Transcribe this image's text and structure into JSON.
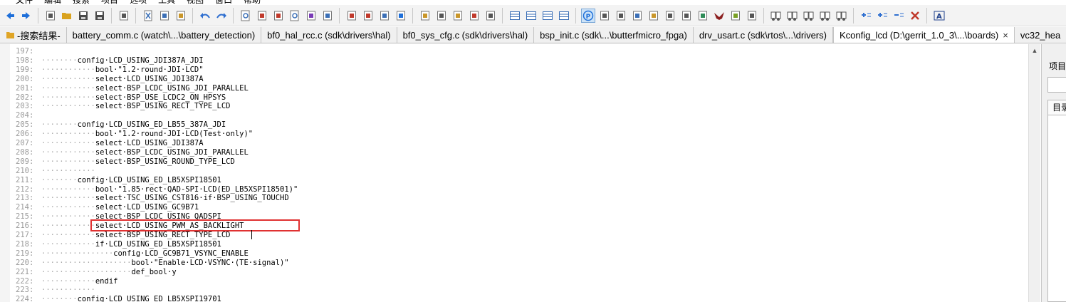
{
  "menu": [
    "文件",
    "编辑",
    "搜索",
    "项目",
    "选项",
    "工具",
    "视图",
    "窗口",
    "帮助"
  ],
  "toolbar": {
    "icons": [
      {
        "name": "back-arrow-icon",
        "color": "#1e6fd9"
      },
      {
        "name": "forward-arrow-icon",
        "color": "#1e6fd9"
      },
      {
        "sep": true
      },
      {
        "name": "new-file-icon",
        "color": "#555555"
      },
      {
        "name": "open-folder-icon",
        "color": "#d9a21e"
      },
      {
        "name": "save-icon",
        "color": "#4a4a4a"
      },
      {
        "name": "save-all-icon",
        "color": "#4a4a4a"
      },
      {
        "sep": true
      },
      {
        "name": "print-icon",
        "color": "#555555"
      },
      {
        "sep": true
      },
      {
        "name": "cut-icon",
        "color": "#3b6fb6"
      },
      {
        "name": "copy-icon",
        "color": "#3b6fb6"
      },
      {
        "name": "paste-icon",
        "color": "#c9962a"
      },
      {
        "sep": true
      },
      {
        "name": "undo-icon",
        "color": "#2f6fd0"
      },
      {
        "name": "redo-icon",
        "color": "#2f6fd0"
      },
      {
        "sep": true
      },
      {
        "name": "find-icon",
        "color": "#3b6fb6"
      },
      {
        "name": "find-previous-icon",
        "color": "#c0392b"
      },
      {
        "name": "find-next-icon",
        "color": "#c0392b"
      },
      {
        "name": "find-in-files-icon",
        "color": "#3b6fb6"
      },
      {
        "name": "replace-icon",
        "color": "#7a3bb6"
      },
      {
        "name": "web-search-icon",
        "color": "#3b6fb6"
      },
      {
        "sep": true
      },
      {
        "name": "bookmark-prev-icon",
        "color": "#c0392b"
      },
      {
        "name": "bookmark-next-icon",
        "color": "#c0392b"
      },
      {
        "name": "goto-line-icon",
        "color": "#3b6fb6"
      },
      {
        "name": "bookmark-toggle-icon",
        "color": "#1e6fd9"
      },
      {
        "sep": true
      },
      {
        "name": "match-brace-icon",
        "color": "#c9962a"
      },
      {
        "name": "indent-icon",
        "color": "#555555"
      },
      {
        "name": "book-icon",
        "color": "#c9962a"
      },
      {
        "name": "function-icon",
        "color": "#c0392b"
      },
      {
        "name": "tools-icon",
        "color": "#555555"
      },
      {
        "sep": true
      },
      {
        "name": "layout-1-icon",
        "color": "#3b6fb6"
      },
      {
        "name": "layout-2-icon",
        "color": "#3b6fb6"
      },
      {
        "name": "layout-3-icon",
        "color": "#3b6fb6"
      },
      {
        "name": "layout-4-icon",
        "color": "#3b6fb6"
      },
      {
        "sep": true
      },
      {
        "name": "show-whitespace-icon",
        "color": "#1e6fd9",
        "pressed": true
      },
      {
        "name": "fullscreen-icon",
        "color": "#555555"
      },
      {
        "name": "tree-icon",
        "color": "#555555"
      },
      {
        "name": "symbol-icon",
        "color": "#3b6fb6"
      },
      {
        "name": "outline-icon",
        "color": "#c9962a"
      },
      {
        "name": "help-icon",
        "color": "#555555"
      },
      {
        "name": "tag-icon",
        "color": "#555555"
      },
      {
        "name": "package-icon",
        "color": "#2e8b57"
      },
      {
        "name": "bird-icon",
        "color": "#8b1e1e"
      },
      {
        "name": "plugin-icon",
        "color": "#7aa025"
      },
      {
        "name": "grid-icon",
        "color": "#555555"
      },
      {
        "sep": true
      },
      {
        "name": "compare-1-icon",
        "color": "#555555"
      },
      {
        "name": "compare-2-icon",
        "color": "#555555"
      },
      {
        "name": "compare-3-icon",
        "color": "#555555"
      },
      {
        "name": "compare-4-icon",
        "color": "#555555"
      },
      {
        "name": "compare-5-icon",
        "color": "#555555"
      },
      {
        "sep": true
      },
      {
        "name": "add-marker-icon",
        "color": "#2f6fd0"
      },
      {
        "name": "add-item-icon",
        "color": "#2f6fd0"
      },
      {
        "name": "remove-item-icon",
        "color": "#2f6fd0"
      },
      {
        "name": "delete-icon",
        "color": "#c0392b"
      },
      {
        "sep": true
      },
      {
        "name": "font-icon",
        "color": "#1e3f8b"
      }
    ]
  },
  "tabs": [
    {
      "label": "-搜索结果-",
      "icon": true
    },
    {
      "label": "battery_comm.c (watch\\...\\battery_detection)"
    },
    {
      "label": "bf0_hal_rcc.c (sdk\\drivers\\hal)"
    },
    {
      "label": "bf0_sys_cfg.c (sdk\\drivers\\hal)"
    },
    {
      "label": "bsp_init.c (sdk\\...\\butterfmicro_fpga)"
    },
    {
      "label": "drv_usart.c (sdk\\rtos\\...\\drivers)"
    },
    {
      "label": "Kconfig_lcd (D:\\gerrit_1.0_3\\...\\boards)",
      "active": true,
      "close": "×"
    },
    {
      "label": "vc32_hea"
    }
  ],
  "code": [
    {
      "ln": "197:",
      "ws": "",
      "text": ""
    },
    {
      "ln": "198:",
      "ws": "········",
      "text": "config·LCD_USING_JDI387A_JDI"
    },
    {
      "ln": "199:",
      "ws": "············",
      "text": "bool·\"1.2·round·JDI·LCD\""
    },
    {
      "ln": "200:",
      "ws": "············",
      "text": "select·LCD_USING_JDI387A"
    },
    {
      "ln": "201:",
      "ws": "············",
      "text": "select·BSP_LCDC_USING_JDI_PARALLEL"
    },
    {
      "ln": "202:",
      "ws": "············",
      "text": "select·BSP_USE_LCDC2_ON_HPSYS"
    },
    {
      "ln": "203:",
      "ws": "············",
      "text": "select·BSP_USING_RECT_TYPE_LCD"
    },
    {
      "ln": "204:",
      "ws": "",
      "text": ""
    },
    {
      "ln": "205:",
      "ws": "········",
      "text": "config·LCD_USING_ED_LB55_387A_JDI"
    },
    {
      "ln": "206:",
      "ws": "············",
      "text": "bool·\"1.2·round·JDI·LCD(Test·only)\""
    },
    {
      "ln": "207:",
      "ws": "············",
      "text": "select·LCD_USING_JDI387A"
    },
    {
      "ln": "208:",
      "ws": "············",
      "text": "select·BSP_LCDC_USING_JDI_PARALLEL"
    },
    {
      "ln": "209:",
      "ws": "············",
      "text": "select·BSP_USING_ROUND_TYPE_LCD"
    },
    {
      "ln": "210:",
      "ws": "············",
      "text": ""
    },
    {
      "ln": "211:",
      "ws": "········",
      "text": "config·LCD_USING_ED_LB5XSPI18501"
    },
    {
      "ln": "212:",
      "ws": "············",
      "text": "bool·\"1.85·rect·QAD-SPI·LCD(ED_LB5XSPI18501)\""
    },
    {
      "ln": "213:",
      "ws": "············",
      "text": "select·TSC_USING_CST816·if·BSP_USING_TOUCHD"
    },
    {
      "ln": "214:",
      "ws": "············",
      "text": "select·LCD_USING_GC9B71"
    },
    {
      "ln": "215:",
      "ws": "············",
      "text": "select·BSP_LCDC_USING_QADSPI"
    },
    {
      "ln": "216:",
      "ws": "············",
      "text": "select·LCD_USING_PWM_AS_BACKLIGHT"
    },
    {
      "ln": "217:",
      "ws": "············",
      "text": "select·BSP_USING_RECT_TYPE_LCD"
    },
    {
      "ln": "218:",
      "ws": "············",
      "text": "if·LCD_USING_ED_LB5XSPI18501"
    },
    {
      "ln": "219:",
      "ws": "················",
      "text": "config·LCD_GC9B71_VSYNC_ENABLE"
    },
    {
      "ln": "220:",
      "ws": "····················",
      "text": "bool·\"Enable·LCD·VSYNC·(TE·signal)\""
    },
    {
      "ln": "221:",
      "ws": "····················",
      "text": "def_bool·y"
    },
    {
      "ln": "222:",
      "ws": "············",
      "text": "endif"
    },
    {
      "ln": "223:",
      "ws": "············",
      "text": ""
    },
    {
      "ln": "224:",
      "ws": "········",
      "text": "config·LCD_USING_ED_LB5XSPI19701"
    }
  ],
  "side_panel": {
    "title_1": "项目",
    "title_2": "目录"
  },
  "scrollbar": {
    "up_arrow": "▲"
  },
  "highlight_color": "#e03131"
}
